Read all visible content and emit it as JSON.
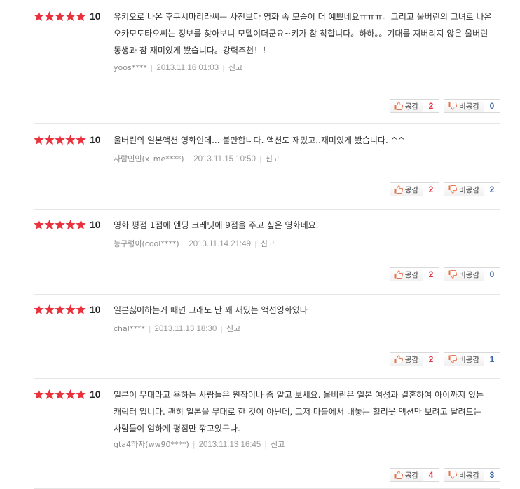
{
  "reviews": [
    {
      "score": "10",
      "comment": "유키오로 나온 후쿠시마리라씨는 사진보다 영화 속 모습이 더 예쁘네요ㅠㅠㅠ。그리고 울버린의 그녀로 나온 오카모토타오씨는 정보를 찾아보니 모델이더군요~키가 참 착합니다。하하。。기대를 져버리지 않은 울버린 동생과 참 재미있게 봤습니다。강력추천！！",
      "author": "yoos****",
      "date": "2013.11.16 01:03",
      "report": "신고",
      "agree_label": "공감",
      "agree_count": "2",
      "disagree_label": "비공감",
      "disagree_count": "0"
    },
    {
      "score": "10",
      "comment": "울버린의 일본액션 영화인데... 불만합니다. 액션도 재밌고..재미있게 봤습니다. ^^",
      "author": "사람인인(x_me****)",
      "date": "2013.11.15 10:50",
      "report": "신고",
      "agree_label": "공감",
      "agree_count": "2",
      "disagree_label": "비공감",
      "disagree_count": "2"
    },
    {
      "score": "10",
      "comment": "영화 평점 1점에 엔딩 크레딧에 9점을 주고 싶은 영화네요.",
      "author": "능구렁이(cool****)",
      "date": "2013.11.14 21:49",
      "report": "신고",
      "agree_label": "공감",
      "agree_count": "2",
      "disagree_label": "비공감",
      "disagree_count": "0"
    },
    {
      "score": "10",
      "comment": "일본싫어하는거 빼면 그래도 난 꽤 재밌는 액션영화였다",
      "author": "chal****",
      "date": "2013.11.13 18:30",
      "report": "신고",
      "agree_label": "공감",
      "agree_count": "2",
      "disagree_label": "비공감",
      "disagree_count": "1"
    },
    {
      "score": "10",
      "comment": "일본이 무대라고 욕하는 사람들은 원작이나 좀 알고 보세요. 울버린은 일본 여성과 결혼하여 아이까지 있는 캐릭터 입니다. 괜히 일본을 무대로 한 것이 아닌데, 그저 마블에서 내놓는 헐리웃 액션만 보려고 달려드는 사람들이 엄하게 평점만 깎고있구나.",
      "author": "gta4하자(ww90****)",
      "date": "2013.11.13 16:45",
      "report": "신고",
      "agree_label": "공감",
      "agree_count": "4",
      "disagree_label": "비공감",
      "disagree_count": "3"
    }
  ],
  "colors": {
    "star": "#e8313c",
    "agree_count": "#e3303f",
    "disagree_count": "#3a64a8",
    "thumb_icon": "#e8734a"
  },
  "icons": {
    "star": "star-icon",
    "agree": "thumbs-up-icon",
    "disagree": "thumbs-down-icon"
  }
}
